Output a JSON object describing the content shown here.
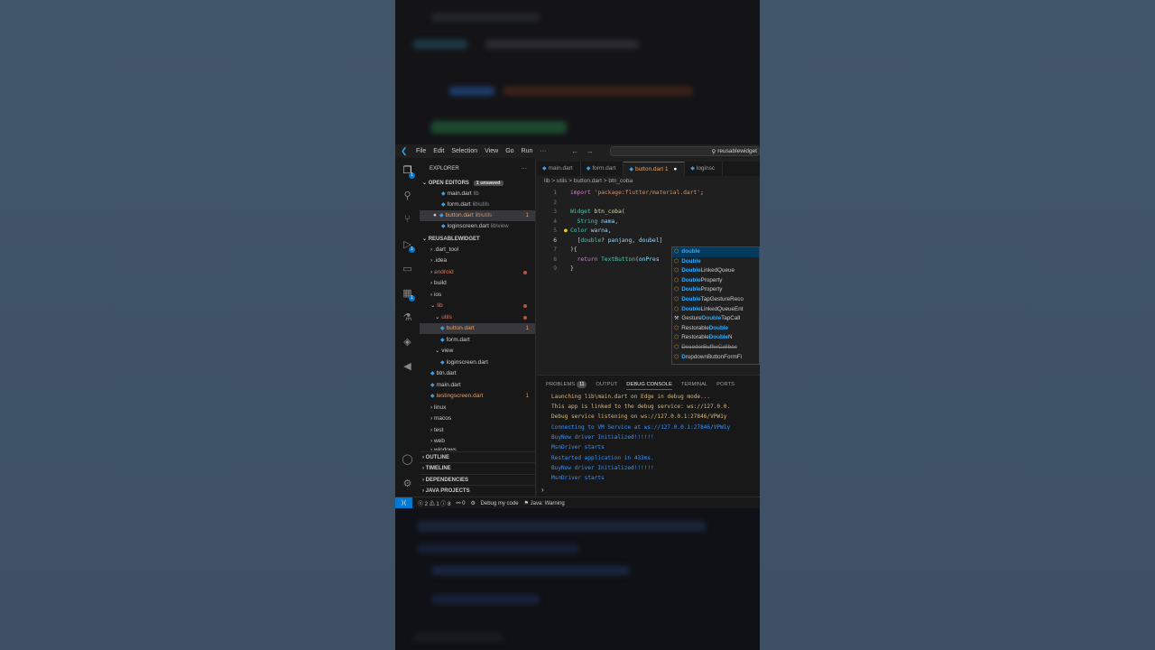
{
  "titlebar": {
    "menu": [
      "File",
      "Edit",
      "Selection",
      "View",
      "Go",
      "Run",
      "···"
    ],
    "search_text": "reusablewidget"
  },
  "sidebar": {
    "title": "EXPLORER",
    "open_editors_label": "OPEN EDITORS",
    "unsaved_badge": "1 unsaved",
    "open_editors": [
      {
        "name": "main.dart",
        "path": "lib"
      },
      {
        "name": "form.dart",
        "path": "lib\\utils"
      },
      {
        "name": "button.dart",
        "path": "lib\\utils",
        "count": "1"
      },
      {
        "name": "loginscreen.dart",
        "path": "lib\\view"
      }
    ],
    "project_label": "REUSABLEWIDGET",
    "tree": [
      {
        "name": ".dart_tool"
      },
      {
        "name": ".idea"
      },
      {
        "name": "android"
      },
      {
        "name": "build"
      },
      {
        "name": "ios"
      },
      {
        "name": "lib"
      },
      {
        "name": "utils"
      },
      {
        "name": "button.dart",
        "count": "1"
      },
      {
        "name": "form.dart"
      },
      {
        "name": "view"
      },
      {
        "name": "loginscreen.dart"
      },
      {
        "name": "btn.dart"
      },
      {
        "name": "main.dart"
      },
      {
        "name": "testingscreen.dart",
        "count": "1"
      },
      {
        "name": "linux"
      },
      {
        "name": "macos"
      },
      {
        "name": "test"
      },
      {
        "name": "web"
      },
      {
        "name": "windows"
      }
    ],
    "sections": [
      "OUTLINE",
      "TIMELINE",
      "DEPENDENCIES",
      "JAVA PROJECTS"
    ]
  },
  "editor": {
    "tabs": [
      "main.dart",
      "form.dart",
      "button.dart 1",
      "loginsc"
    ],
    "breadcrumb": "lib > utils > button.dart > btn_coba",
    "line_numbers": [
      "1",
      "2",
      "3",
      "4",
      "5",
      "6",
      "7",
      "8",
      "9"
    ]
  },
  "suggest": [
    {
      "icon": "class",
      "pre": "",
      "hl": "double",
      "post": ""
    },
    {
      "icon": "class",
      "pre": "",
      "hl": "Double",
      "post": ""
    },
    {
      "icon": "class",
      "pre": "",
      "hl": "Double",
      "post": "LinkedQueue"
    },
    {
      "icon": "class",
      "pre": "",
      "hl": "Double",
      "post": "Property"
    },
    {
      "icon": "class",
      "pre": "",
      "hl": "Double",
      "post": "Property"
    },
    {
      "icon": "class",
      "pre": "",
      "hl": "Double",
      "post": "TapGestureReco"
    },
    {
      "icon": "class",
      "pre": "",
      "hl": "Double",
      "post": "LinkedQueueEnt"
    },
    {
      "icon": "wrench",
      "pre": "Gesture",
      "hl": "Double",
      "post": "TapCall"
    },
    {
      "icon": "class",
      "pre": "Restorable",
      "hl": "Double",
      "post": ""
    },
    {
      "icon": "class",
      "pre": "Restorable",
      "hl": "Double",
      "post": "N"
    },
    {
      "icon": "class",
      "pre": "DecoderBufferCallbac",
      "hl": "",
      "post": ""
    },
    {
      "icon": "class",
      "pre": "D",
      "hl": "ropdownButtonFormFi",
      "post": ""
    }
  ],
  "panel": {
    "tabs": [
      "PROBLEMS",
      "OUTPUT",
      "DEBUG CONSOLE",
      "TERMINAL",
      "PORTS"
    ],
    "problems_count": "11",
    "console": [
      "Launching lib\\main.dart on Edge in debug mode...",
      "This app is linked to the debug service: ws://127.0.0.",
      "Debug service listening on ws://127.0.0.1:27846/VPW1y",
      "Connecting to VM Service at ws://127.0.0.1:27846/VPW1y",
      "BuyNow driver Initialized!!!!!!",
      "MsnDriver starts",
      "Restarted application in 433ms.",
      "BuyNow driver Initialized!!!!!!",
      "MsnDriver starts"
    ]
  },
  "statusbar": {
    "errors": "2",
    "warnings": "1",
    "info": "8",
    "ports": "0",
    "debug": "Debug my code",
    "java": "Java: Warning"
  },
  "colors": {
    "accent": "#0078d4",
    "editor_bg": "#1f1f1f",
    "sidebar_bg": "#181818",
    "modified": "#e2a068"
  }
}
